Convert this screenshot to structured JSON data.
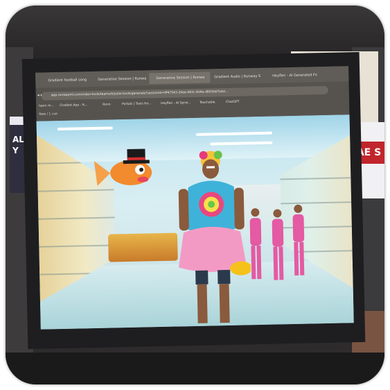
{
  "scene": {
    "description_free": true
  },
  "banners": {
    "left_text": "AL\nY",
    "right_text": "AE S"
  },
  "browser": {
    "tabs": [
      {
        "label": "Gradient football song"
      },
      {
        "label": "Generative Session | Runwa"
      },
      {
        "label": "Generative Session | Runwa"
      },
      {
        "label": "Gradient Audio | Runway S"
      },
      {
        "label": "Heyflen - AI Generated Fo"
      }
    ],
    "address": "app.runwayml.com/video-tools/teams/krjul/ai-tools/generate?sessionId=9f47543-20ee-483c-8d4e-d803b67b4d...",
    "bookmarks": [
      {
        "label": "learn m..."
      },
      {
        "label": "Chatbot App - R..."
      },
      {
        "label": "Runn"
      },
      {
        "label": "Portals | Tools for..."
      },
      {
        "label": "Heyflen - AI Sprai..."
      },
      {
        "label": "Teachable"
      },
      {
        "label": "ChatGPT"
      }
    ],
    "subheading": "New / 1 cue"
  },
  "colors": {
    "frame_bg": "#2d2b2c",
    "video_sky": "#bfe3f0",
    "banner_red": "#c0262c"
  }
}
